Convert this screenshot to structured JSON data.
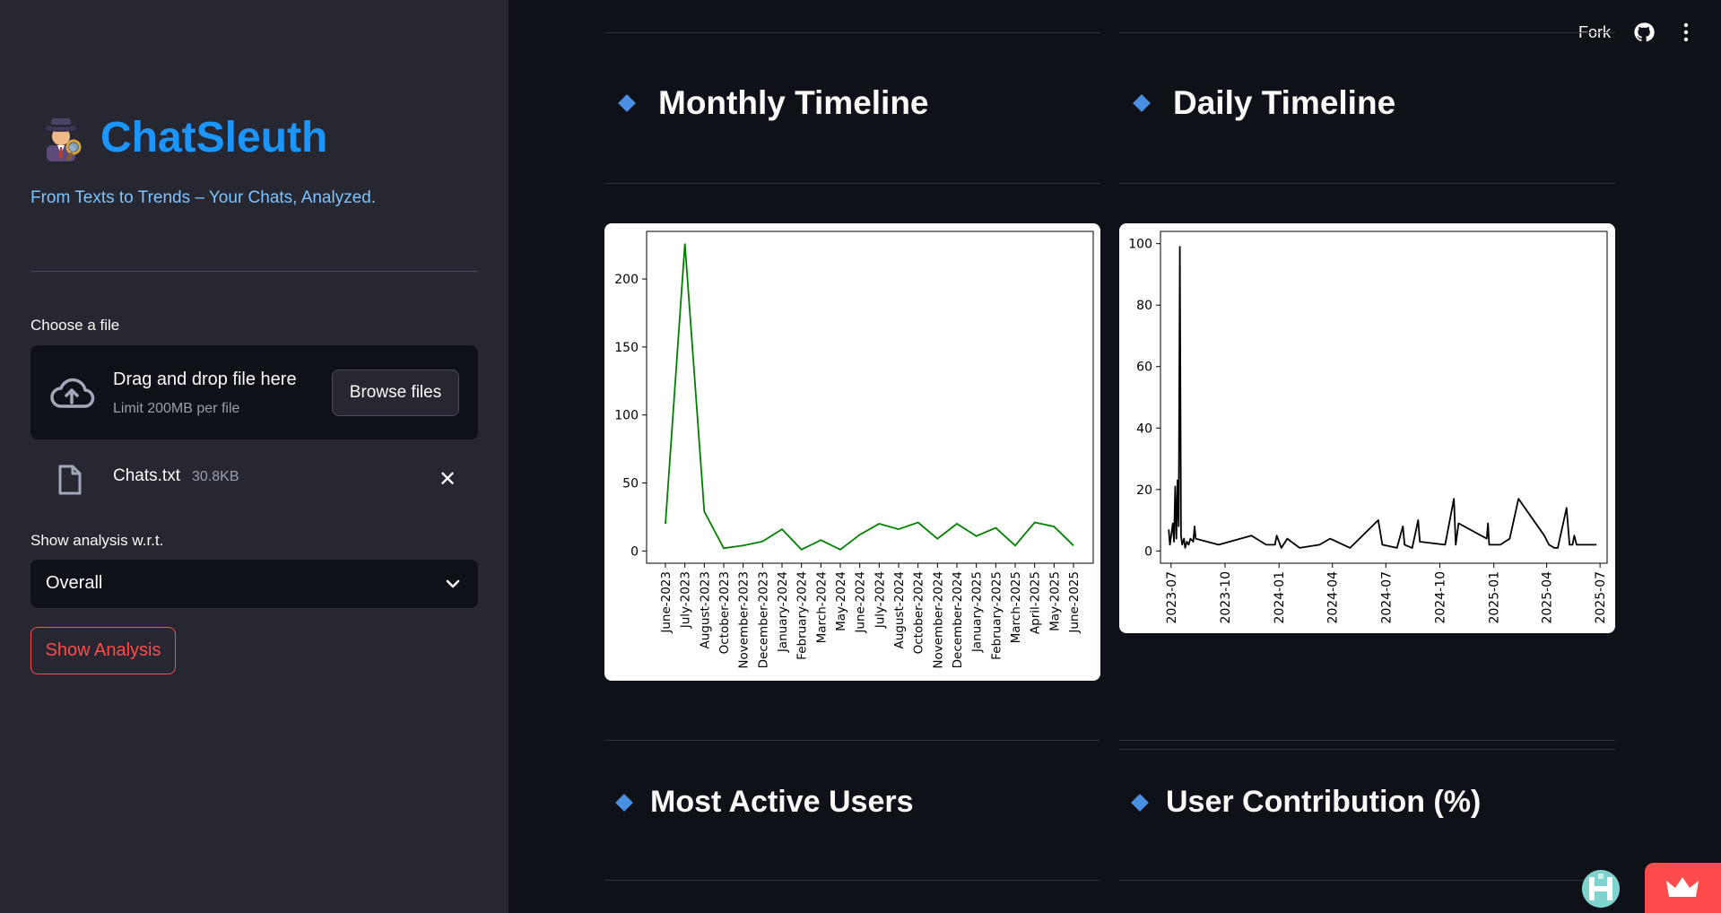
{
  "app": {
    "title": "ChatSleuth",
    "tagline": "From Texts to Trends – Your Chats, Analyzed.",
    "logo_icon": "detective-emoji"
  },
  "sidebar": {
    "file_label": "Choose a file",
    "dropzone_main": "Drag and drop file here",
    "dropzone_sub": "Limit 200MB per file",
    "browse_label": "Browse files",
    "uploaded_file": {
      "name": "Chats.txt",
      "size": "30.8KB"
    },
    "select_label": "Show analysis w.r.t.",
    "select_value": "Overall",
    "show_button": "Show Analysis"
  },
  "toolbar": {
    "fork_label": "Fork"
  },
  "sections": {
    "monthly": "Monthly Timeline",
    "daily": "Daily Timeline",
    "active_users": "Most Active Users",
    "contribution": "User Contribution (%)"
  },
  "colors": {
    "accent": "#1c96ff",
    "danger": "#ff4b4b",
    "monthly_line": "#008000",
    "daily_line": "#000000"
  },
  "chart_data": [
    {
      "type": "line",
      "categories": [
        "June-2023",
        "July-2023",
        "August-2023",
        "October-2023",
        "November-2023",
        "December-2023",
        "January-2024",
        "February-2024",
        "March-2024",
        "May-2024",
        "June-2024",
        "July-2024",
        "August-2024",
        "October-2024",
        "November-2024",
        "December-2024",
        "January-2025",
        "February-2025",
        "March-2025",
        "April-2025",
        "May-2025",
        "June-2025"
      ],
      "series": [
        {
          "values": [
            20,
            226,
            29,
            2,
            4,
            7,
            16,
            1,
            8,
            1,
            12,
            20,
            16,
            21,
            9,
            20,
            11,
            17,
            4,
            21,
            18,
            4
          ]
        }
      ],
      "y_ticks": [
        0,
        50,
        100,
        150,
        200
      ],
      "ylim": [
        -9,
        235
      ],
      "color": "#008000"
    },
    {
      "type": "line",
      "x_ticks": [
        "2023-07",
        "2023-10",
        "2024-01",
        "2024-04",
        "2024-07",
        "2024-10",
        "2025-01",
        "2025-04",
        "2025-07"
      ],
      "series": [
        {
          "points": [
            [
              "2023-06-27",
              7
            ],
            [
              "2023-06-29",
              2
            ],
            [
              "2023-07-02",
              6
            ],
            [
              "2023-07-04",
              9
            ],
            [
              "2023-07-06",
              3
            ],
            [
              "2023-07-08",
              21
            ],
            [
              "2023-07-10",
              4
            ],
            [
              "2023-07-12",
              23
            ],
            [
              "2023-07-14",
              8
            ],
            [
              "2023-07-16",
              99
            ],
            [
              "2023-07-18",
              5
            ],
            [
              "2023-07-20",
              2
            ],
            [
              "2023-07-23",
              4
            ],
            [
              "2023-07-25",
              1
            ],
            [
              "2023-07-28",
              3
            ],
            [
              "2023-07-31",
              2
            ],
            [
              "2023-08-03",
              4
            ],
            [
              "2023-08-08",
              3
            ],
            [
              "2023-08-10",
              8
            ],
            [
              "2023-08-12",
              4
            ],
            [
              "2023-09-20",
              2
            ],
            [
              "2023-11-15",
              5
            ],
            [
              "2023-12-10",
              2
            ],
            [
              "2023-12-25",
              2
            ],
            [
              "2023-12-28",
              5
            ],
            [
              "2024-01-05",
              1
            ],
            [
              "2024-01-15",
              4
            ],
            [
              "2024-02-05",
              1
            ],
            [
              "2024-03-10",
              2
            ],
            [
              "2024-03-28",
              4
            ],
            [
              "2024-05-01",
              1
            ],
            [
              "2024-06-18",
              10
            ],
            [
              "2024-06-25",
              2
            ],
            [
              "2024-07-20",
              1
            ],
            [
              "2024-07-30",
              8
            ],
            [
              "2024-08-02",
              2
            ],
            [
              "2024-08-15",
              1
            ],
            [
              "2024-08-25",
              10
            ],
            [
              "2024-08-28",
              3
            ],
            [
              "2024-10-10",
              2
            ],
            [
              "2024-10-25",
              17
            ],
            [
              "2024-10-28",
              2
            ],
            [
              "2024-11-02",
              9
            ],
            [
              "2024-12-20",
              4
            ],
            [
              "2024-12-22",
              9
            ],
            [
              "2024-12-24",
              2
            ],
            [
              "2025-01-05",
              2
            ],
            [
              "2025-01-12",
              2
            ],
            [
              "2025-01-28",
              4
            ],
            [
              "2025-02-12",
              17
            ],
            [
              "2025-03-28",
              5
            ],
            [
              "2025-04-05",
              2
            ],
            [
              "2025-04-14",
              1
            ],
            [
              "2025-04-20",
              1
            ],
            [
              "2025-05-05",
              14
            ],
            [
              "2025-05-10",
              2
            ],
            [
              "2025-05-15",
              2
            ],
            [
              "2025-05-18",
              5
            ],
            [
              "2025-05-22",
              2
            ],
            [
              "2025-06-25",
              2
            ]
          ]
        }
      ],
      "y_ticks": [
        0,
        20,
        40,
        60,
        80,
        100
      ],
      "ylim": [
        -4,
        104
      ],
      "color": "#000000"
    }
  ]
}
